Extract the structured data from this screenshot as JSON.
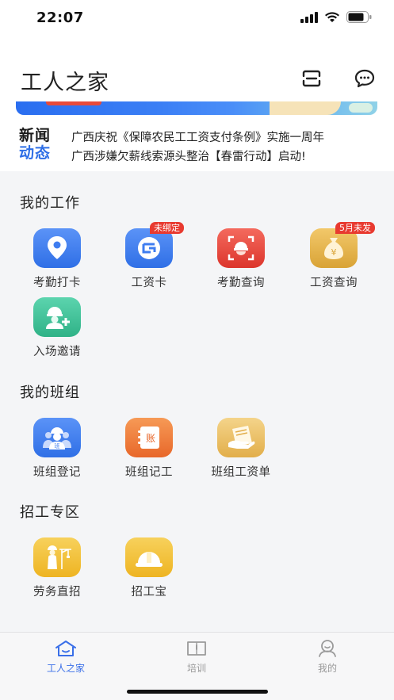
{
  "status_bar": {
    "time": "22:07"
  },
  "header": {
    "title": "工人之家",
    "scan_icon": "scan-icon",
    "message_icon": "chat-bubble-icon"
  },
  "news": {
    "logo_line1": "新闻",
    "logo_line2": "动态",
    "items": [
      "广西庆祝《保障农民工工资支付条例》实施一周年",
      "广西涉嫌欠薪线索源头整治【春雷行动】启动!"
    ]
  },
  "sections": {
    "my_work": {
      "title": "我的工作",
      "items": [
        {
          "label": "考勤打卡",
          "icon": "location-pin-icon",
          "color": "#3f7df0"
        },
        {
          "label": "工资卡",
          "icon": "bank-card-icon",
          "color": "#3f7df0",
          "badge": "未绑定"
        },
        {
          "label": "考勤查询",
          "icon": "helmet-scan-icon",
          "color": "#e9453c"
        },
        {
          "label": "工资查询",
          "icon": "money-bag-icon",
          "color": "#e8b44a",
          "badge": "5月未发"
        },
        {
          "label": "入场邀请",
          "icon": "add-worker-icon",
          "color": "#3ec29a"
        }
      ]
    },
    "my_team": {
      "title": "我的班组",
      "items": [
        {
          "label": "班组登记",
          "icon": "team-icon",
          "color": "#3f7df0"
        },
        {
          "label": "班组记工",
          "icon": "ledger-icon",
          "color": "#ef7d3a"
        },
        {
          "label": "班组工资单",
          "icon": "payslip-icon",
          "color": "#e8b44a"
        }
      ]
    },
    "recruit": {
      "title": "招工专区",
      "items": [
        {
          "label": "劳务直招",
          "icon": "worker-crane-icon",
          "color": "#f2c13b"
        },
        {
          "label": "招工宝",
          "icon": "hard-hat-icon",
          "color": "#f2c13b"
        }
      ]
    }
  },
  "tabbar": {
    "tabs": [
      {
        "label": "工人之家",
        "icon": "home-icon",
        "active": true
      },
      {
        "label": "培训",
        "icon": "book-icon",
        "active": false
      },
      {
        "label": "我的",
        "icon": "user-icon",
        "active": false
      }
    ]
  },
  "colors": {
    "accent": "#3a6fe8",
    "badge": "#e83a30"
  }
}
